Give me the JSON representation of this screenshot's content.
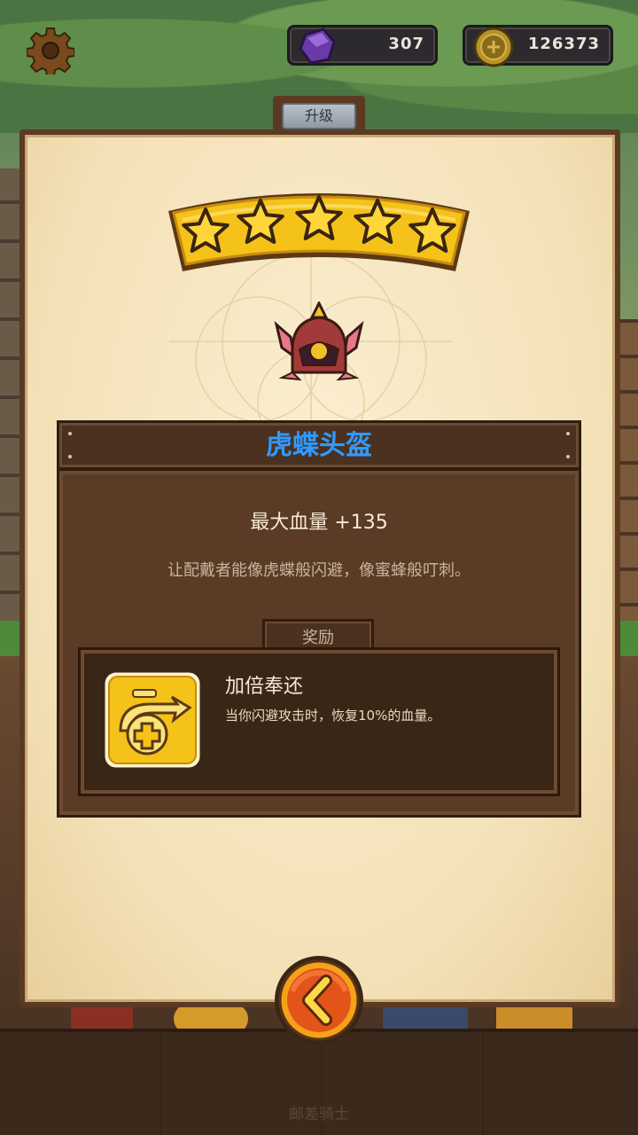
{
  "hud": {
    "gems": "307",
    "coins": "126373"
  },
  "panel": {
    "tab_label": "升级",
    "stars": 5,
    "item_name": "虎蝶头盔",
    "stat_line": "最大血量 +135",
    "description": "让配戴者能像虎蝶般闪避，像蜜蜂般叮刺。"
  },
  "reward": {
    "tab_label": "奖励",
    "name": "加倍奉还",
    "description": "当你闪避攻击时，恢复10%的血量。"
  },
  "footer": {
    "text": "邮差骑士"
  },
  "colors": {
    "title_blue": "#2f9bff",
    "parchment": "#f3e0b6",
    "panel_brown": "#5a3a22",
    "gold": "#f5c21a",
    "back_button_orange": "#e2541a"
  },
  "icons": {
    "settings": "gear-icon",
    "gems": "gem-icon",
    "coins": "coin-icon",
    "item": "helmet-icon",
    "reward": "heal-ability-icon",
    "back": "back-arrow-icon"
  }
}
